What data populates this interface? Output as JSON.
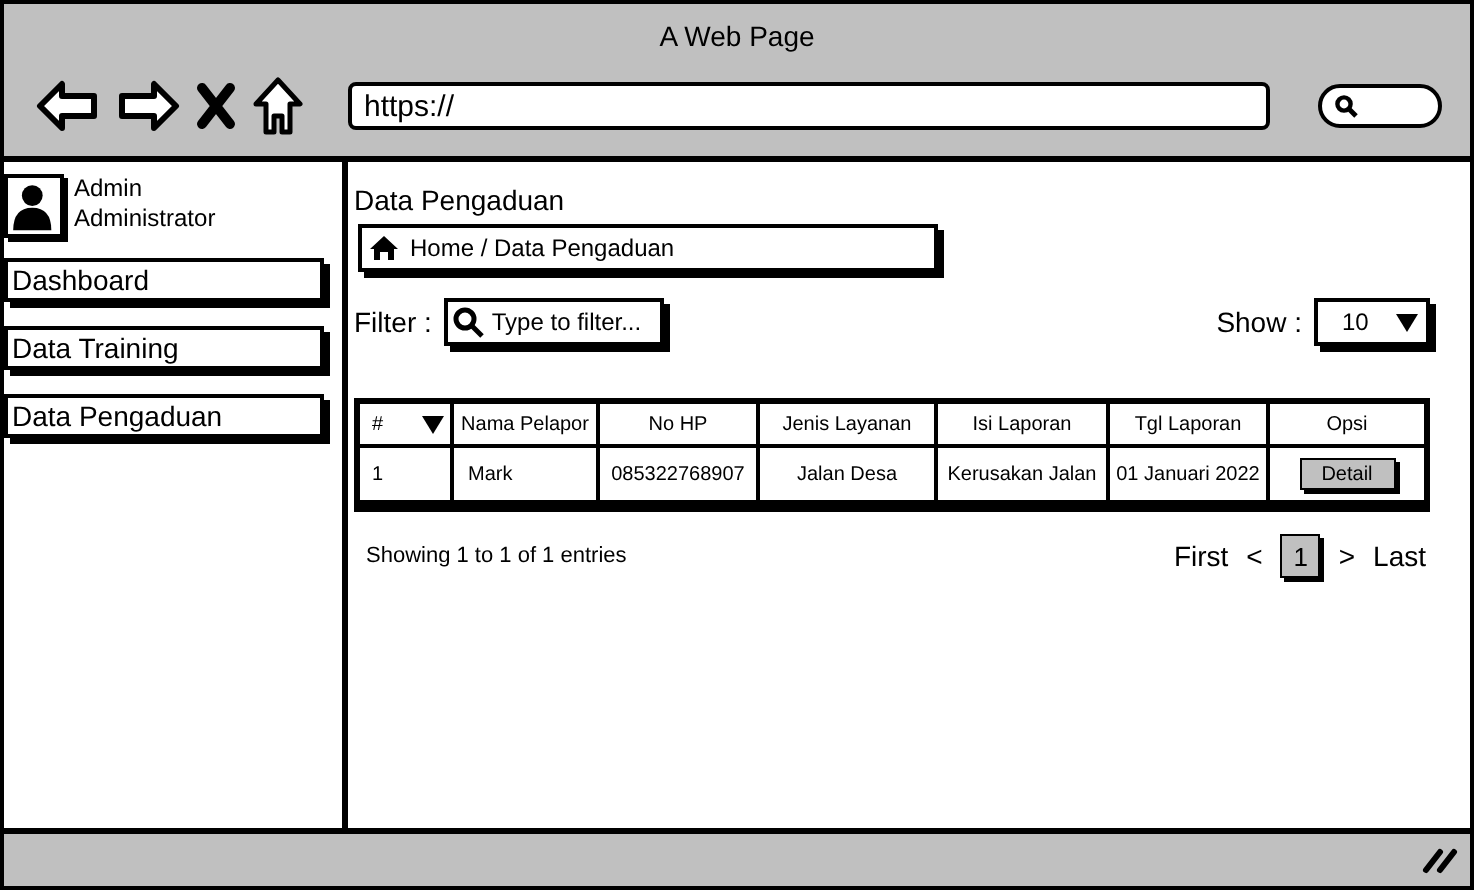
{
  "browser": {
    "title": "A Web Page",
    "url": "https://"
  },
  "sidebar": {
    "user": {
      "name": "Admin",
      "role": "Administrator"
    },
    "items": [
      {
        "label": "Dashboard"
      },
      {
        "label": "Data Training"
      },
      {
        "label": "Data Pengaduan"
      }
    ]
  },
  "main": {
    "title": "Data Pengaduan",
    "breadcrumb": "Home / Data Pengaduan",
    "filter": {
      "label": "Filter :",
      "placeholder": "Type to filter..."
    },
    "show": {
      "label": "Show :",
      "value": "10"
    },
    "table": {
      "columns": [
        "#",
        "Nama Pelapor",
        "No HP",
        "Jenis Layanan",
        "Isi Laporan",
        "Tgl Laporan",
        "Opsi"
      ],
      "rows": [
        {
          "cells": [
            "1",
            "Mark",
            "085322768907",
            "Jalan Desa",
            "Kerusakan Jalan",
            "01 Januari 2022"
          ],
          "action": "Detail"
        }
      ]
    },
    "info": "Showing 1 to 1 of 1 entries",
    "pagination": {
      "first": "First",
      "prev": "<",
      "pages": [
        {
          "label": "1",
          "selected": true
        }
      ],
      "next": ">",
      "last": "Last"
    }
  }
}
